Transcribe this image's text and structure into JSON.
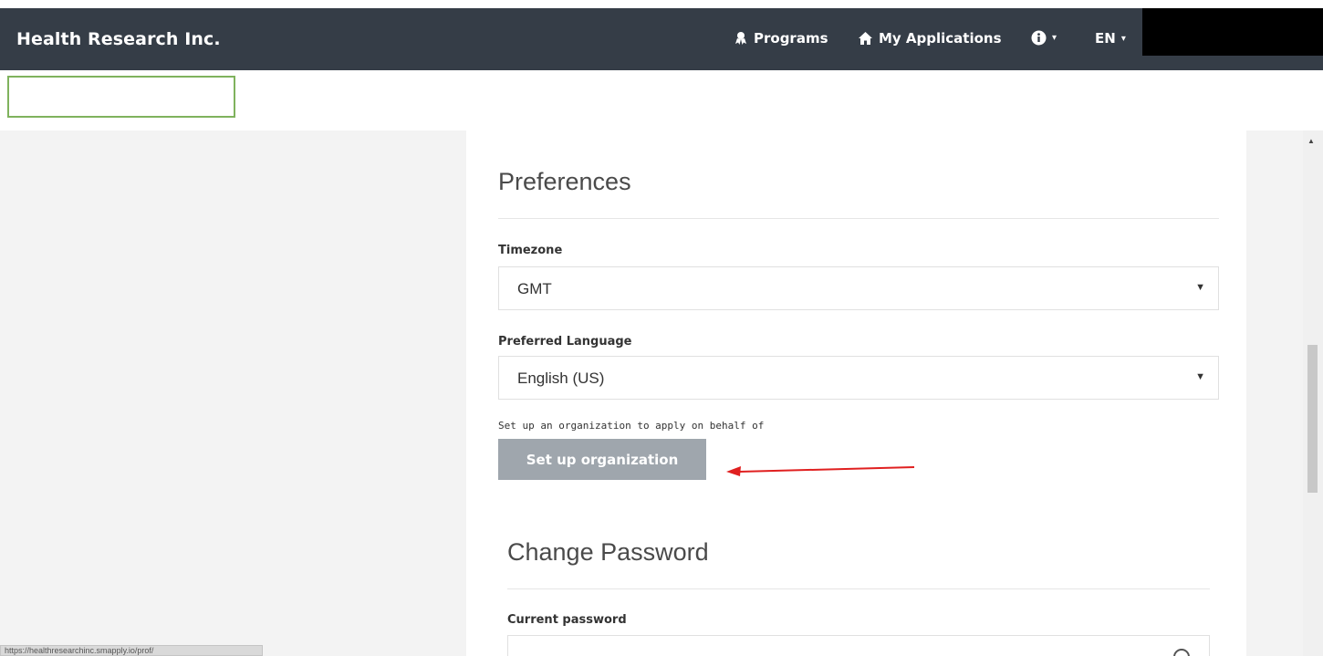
{
  "navbar": {
    "brand": "Health Research Inc.",
    "programs_label": "Programs",
    "applications_label": "My Applications",
    "language_label": "EN",
    "caret": "▾"
  },
  "preferences": {
    "title": "Preferences",
    "timezone_label": "Timezone",
    "timezone_value": "GMT",
    "language_label": "Preferred Language",
    "language_value": "English (US)",
    "org_help": "Set up an organization to apply on behalf of",
    "org_button": "Set up organization"
  },
  "password": {
    "title": "Change Password",
    "current_label": "Current password"
  },
  "statusbar": {
    "url": "https://healthresearchinc.smapply.io/prof/"
  },
  "colors": {
    "navbar_bg": "#353d47",
    "button_bg": "#9fa6ad",
    "annotation_arrow": "#e02020",
    "highlight_box": "#7fb25d"
  },
  "icons": {
    "programs": "award-icon",
    "applications": "home-icon",
    "info": "info-icon",
    "caret": "caret-down-icon",
    "password_toggle": "eye-icon"
  }
}
